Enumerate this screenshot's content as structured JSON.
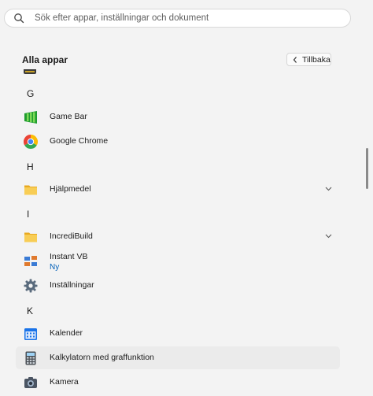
{
  "search": {
    "placeholder": "Sök efter appar, inställningar och dokument"
  },
  "header": {
    "title": "Alla appar",
    "back_label": "Tillbaka"
  },
  "apps": {
    "letter_g": "G",
    "letter_h": "H",
    "letter_i": "I",
    "letter_k": "K",
    "game_bar": "Game Bar",
    "google_chrome": "Google Chrome",
    "hjalpmedel": "Hjälpmedel",
    "incredibuild": "IncrediBuild",
    "instant_vb": "Instant VB",
    "instant_vb_badge": "Ny",
    "installningar": "Inställningar",
    "kalender": "Kalender",
    "kalkylatorn": "Kalkylatorn med graffunktion",
    "kamera": "Kamera"
  },
  "icons": {
    "search": "search-icon",
    "back": "chevron-left-icon",
    "expand": "chevron-down-icon",
    "game_bar": "game-bar-icon",
    "chrome": "chrome-icon",
    "folder": "folder-icon",
    "instant_vb": "instant-vb-icon",
    "settings": "gear-icon",
    "calendar": "calendar-icon",
    "calculator": "calculator-icon",
    "camera": "camera-icon"
  },
  "colors": {
    "accent": "#005fb8",
    "background": "#f3f3f3",
    "folder": "#f4c24d"
  }
}
